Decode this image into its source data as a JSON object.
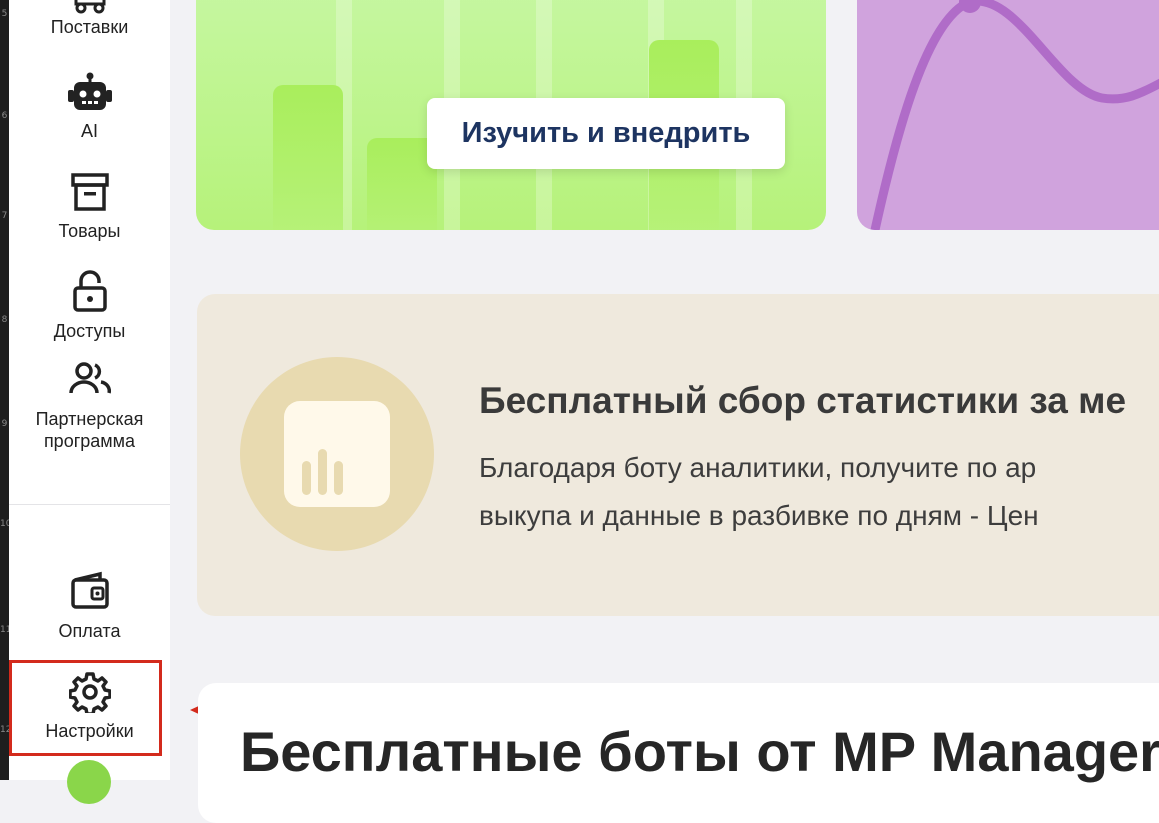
{
  "ruler": {
    "marks": [
      "5",
      "6",
      "7",
      "8",
      "9",
      "10",
      "11",
      "12"
    ]
  },
  "sidebar": {
    "items": [
      {
        "label": "Поставки",
        "icon": "truck-icon"
      },
      {
        "label": "AI",
        "icon": "robot-icon"
      },
      {
        "label": "Товары",
        "icon": "archive-box-icon"
      },
      {
        "label": "Доступы",
        "icon": "unlock-icon"
      },
      {
        "label": "Партнерская программа",
        "icon": "users-icon"
      }
    ],
    "bottom_items": [
      {
        "label": "Оплата",
        "icon": "wallet-icon"
      },
      {
        "label": "Настройки",
        "icon": "gear-icon",
        "highlighted": true
      }
    ]
  },
  "hero": {
    "cta_label": "Изучить и внедрить"
  },
  "promo": {
    "title": "Бесплатный сбор статистики за ме",
    "text_line1": "Благодаря боту аналитики, получите по ар",
    "text_line2": "выкупа и данные в разбивке по дням - Цен"
  },
  "bots_section": {
    "title": "Бесплатные боты от MP Manager"
  },
  "colors": {
    "highlight": "#d32a1c",
    "arrow": "#d32a1c",
    "green_card": "#b6f27a",
    "purple_card": "#d0a3dd",
    "promo_bg": "#efe9dd",
    "cta_text": "#1d3461"
  }
}
